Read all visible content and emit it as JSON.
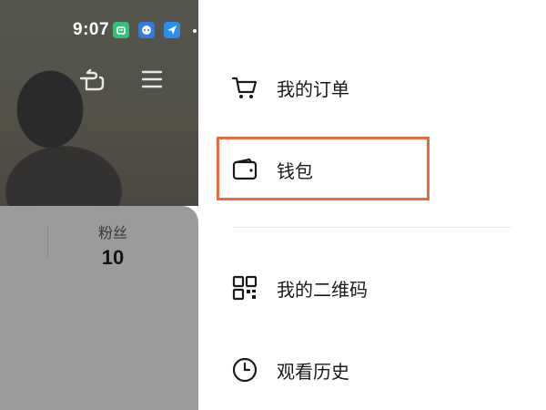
{
  "status_bar": {
    "time": "9:07",
    "icons": [
      "mi-home-icon",
      "bot-app-icon",
      "send-app-icon"
    ]
  },
  "profile": {
    "fans_label": "粉丝",
    "fans_count": "10"
  },
  "drawer": {
    "items": [
      {
        "label": "我的订单",
        "icon": "cart-icon"
      },
      {
        "label": "钱包",
        "icon": "wallet-icon"
      },
      {
        "label": "我的二维码",
        "icon": "qr-code-icon"
      },
      {
        "label": "观看历史",
        "icon": "clock-icon"
      }
    ]
  },
  "colors": {
    "highlight": "#ea6b3e",
    "overlay_card": "#9b9b9b",
    "text_primary": "#1a1a1a"
  }
}
